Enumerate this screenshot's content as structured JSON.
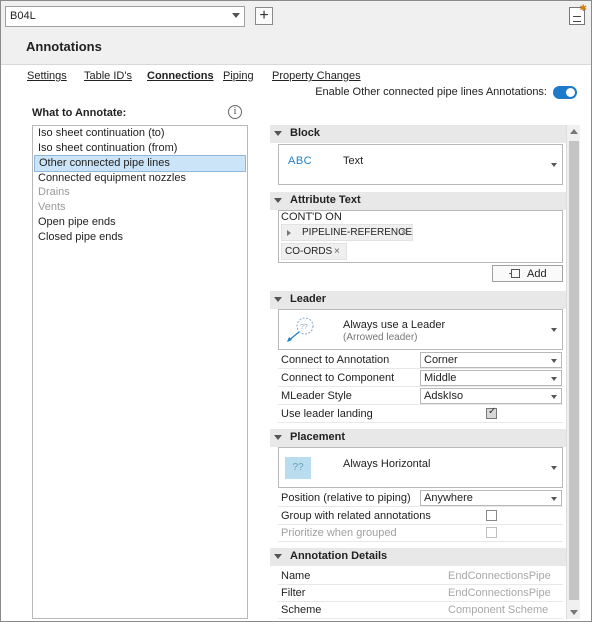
{
  "header": {
    "drawing_select": "B04L",
    "add_symbol": "+",
    "title": "Annotations"
  },
  "tabs": [
    {
      "label": "Settings"
    },
    {
      "label": "Table ID's"
    },
    {
      "label": "Connections"
    },
    {
      "label": "Piping"
    },
    {
      "label": "Property Changes"
    }
  ],
  "enable_toggle": {
    "label": "Enable Other connected pipe lines Annotations:",
    "on": true
  },
  "what_to_annotate": {
    "label": "What to Annotate:",
    "info_symbol": "i",
    "items": [
      {
        "label": "Iso sheet continuation (to)",
        "state": "normal"
      },
      {
        "label": "Iso sheet continuation (from)",
        "state": "normal"
      },
      {
        "label": "Other connected pipe lines",
        "state": "selected"
      },
      {
        "label": "Connected equipment nozzles",
        "state": "normal"
      },
      {
        "label": "Drains",
        "state": "disabled"
      },
      {
        "label": "Vents",
        "state": "disabled"
      },
      {
        "label": "Open pipe ends",
        "state": "normal"
      },
      {
        "label": "Closed pipe ends",
        "state": "normal"
      }
    ]
  },
  "block": {
    "title": "Block",
    "icon_text": "ABC",
    "value": "Text"
  },
  "attribute_text": {
    "title": "Attribute Text",
    "prefix": "CONT'D ON",
    "chips": [
      {
        "label": "PIPELINE-REFERENCE",
        "expandable": true
      },
      {
        "label": "CO-ORDS",
        "expandable": false
      }
    ],
    "remove_symbol": "×",
    "add_label": "Add"
  },
  "leader": {
    "title": "Leader",
    "icon_text": "??",
    "style_name": "Always use a Leader",
    "style_sub": "(Arrowed leader)",
    "rows": [
      {
        "key": "Connect to Annotation",
        "value": "Corner"
      },
      {
        "key": "Connect to Component",
        "value": "Middle"
      },
      {
        "key": "MLeader Style",
        "value": "AdskIso"
      }
    ],
    "landing": {
      "key": "Use leader landing",
      "checked": true
    }
  },
  "placement": {
    "title": "Placement",
    "icon_text": "??",
    "style_name": "Always Horizontal",
    "position": {
      "key": "Position (relative to piping)",
      "value": "Anywhere"
    },
    "group": {
      "key": "Group with related annotations",
      "checked": false
    },
    "prioritize": {
      "key": "Prioritize when grouped",
      "checked": false
    }
  },
  "details": {
    "title": "Annotation Details",
    "rows": [
      {
        "key": "Name",
        "value": "EndConnectionsPipe"
      },
      {
        "key": "Filter",
        "value": "EndConnectionsPipe"
      },
      {
        "key": "Scheme",
        "value": "Component Scheme"
      }
    ]
  },
  "colors": {
    "accent": "#1e7ac8",
    "selection": "#cce4f7",
    "section_header": "#e8e8e8"
  }
}
